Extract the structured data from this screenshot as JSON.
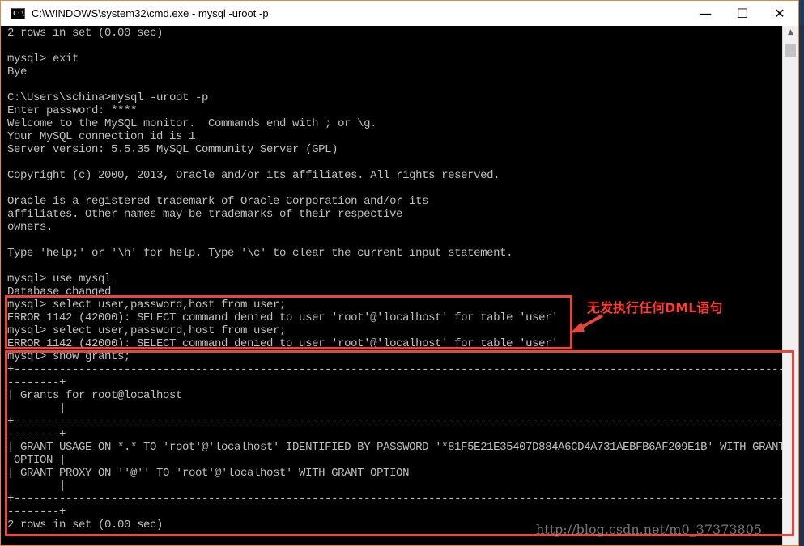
{
  "window": {
    "title": "C:\\WINDOWS\\system32\\cmd.exe - mysql  -uroot -p",
    "icon_label": "C:\\"
  },
  "controls": {
    "minimize": "—",
    "maximize": "☐",
    "close": "✕"
  },
  "console_lines": [
    "2 rows in set (0.00 sec)",
    "",
    "mysql> exit",
    "Bye",
    "",
    "C:\\Users\\schina>mysql -uroot -p",
    "Enter password: ****",
    "Welcome to the MySQL monitor.  Commands end with ; or \\g.",
    "Your MySQL connection id is 1",
    "Server version: 5.5.35 MySQL Community Server (GPL)",
    "",
    "Copyright (c) 2000, 2013, Oracle and/or its affiliates. All rights reserved.",
    "",
    "Oracle is a registered trademark of Oracle Corporation and/or its",
    "affiliates. Other names may be trademarks of their respective",
    "owners.",
    "",
    "Type 'help;' or '\\h' for help. Type '\\c' to clear the current input statement.",
    "",
    "mysql> use mysql",
    "Database changed",
    "mysql> select user,password,host from user;",
    "ERROR 1142 (42000): SELECT command denied to user 'root'@'localhost' for table 'user'",
    "mysql> select user,password,host from user;",
    "ERROR 1142 (42000): SELECT command denied to user 'root'@'localhost' for table 'user'",
    "mysql> show grants;",
    "+--------------------------------------------------------------------------------------------------------------------------",
    "--------+",
    "| Grants for root@localhost",
    "        |",
    "+--------------------------------------------------------------------------------------------------------------------------",
    "--------+",
    "| GRANT USAGE ON *.* TO 'root'@'localhost' IDENTIFIED BY PASSWORD '*81F5E21E35407D884A6CD4A731AEBFB6AF209E1B' WITH GRANT",
    " OPTION |",
    "| GRANT PROXY ON ''@'' TO 'root'@'localhost' WITH GRANT OPTION",
    "        |",
    "+--------------------------------------------------------------------------------------------------------------------------",
    "--------+",
    "2 rows in set (0.00 sec)"
  ],
  "annotation": {
    "text": "无发执行任何DML语句"
  },
  "watermark": {
    "text": "http://blog.csdn.net/m0_37373805"
  },
  "colors": {
    "highlight": "#e8453c",
    "annotation": "#ff3b30",
    "console_text": "#c0c0c0"
  }
}
